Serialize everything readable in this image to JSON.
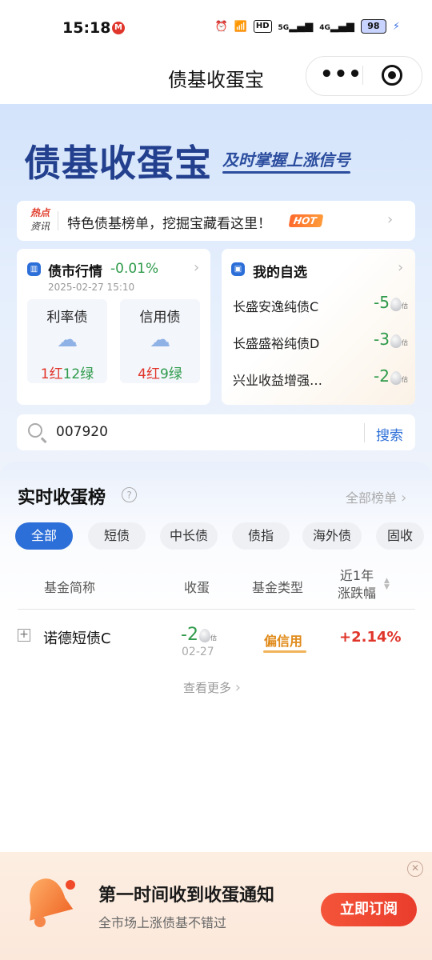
{
  "status_bar": {
    "time": "15:18",
    "badge": "M",
    "icons": [
      "alarm-icon",
      "wifi-icon",
      "HD",
      "5G",
      "4G"
    ],
    "battery": "98"
  },
  "nav": {
    "title": "债基收蛋宝",
    "more": "•••"
  },
  "banner": {
    "brand": "债基收蛋宝",
    "slogan": "及时掌握上涨信号"
  },
  "hot": {
    "tag_line1": "热点",
    "tag_line2": "资讯",
    "text": "特色债基榜单，挖掘宝藏看这里！",
    "badge": "HOT"
  },
  "market": {
    "title": "债市行情",
    "change": "-0.01%",
    "datetime": "2025-02-27 15:10",
    "items": [
      {
        "name": "利率债",
        "red": "1红",
        "green": "12绿"
      },
      {
        "name": "信用债",
        "red": "4红",
        "green": "9绿"
      }
    ]
  },
  "watchlist": {
    "title": "我的自选",
    "items": [
      {
        "name": "长盛安逸纯债C",
        "value": "-5",
        "tag": "估"
      },
      {
        "name": "长盛盛裕纯债D",
        "value": "-3",
        "tag": "估"
      },
      {
        "name": "兴业收益增强…",
        "value": "-2",
        "tag": "估"
      }
    ]
  },
  "search": {
    "value": "007920",
    "button": "搜索"
  },
  "ranking": {
    "title": "实时收蛋榜",
    "help": "?",
    "all_link": "全部榜单",
    "tabs": [
      "全部",
      "短债",
      "中长债",
      "债指",
      "海外债",
      "固收"
    ],
    "active_tab": 0,
    "headers": {
      "name": "基金简称",
      "egg": "收蛋",
      "type": "基金类型",
      "ret_line1": "近1年",
      "ret_line2": "涨跌幅"
    },
    "rows": [
      {
        "name": "诺德短债C",
        "egg": "-2",
        "egg_tag": "估",
        "date": "02-27",
        "type": "偏信用",
        "ret": "+2.14%"
      }
    ],
    "more": "查看更多"
  },
  "subscribe": {
    "title": "第一时间收到收蛋通知",
    "subtitle": "全市场上涨债基不错过",
    "button": "立即订阅"
  }
}
